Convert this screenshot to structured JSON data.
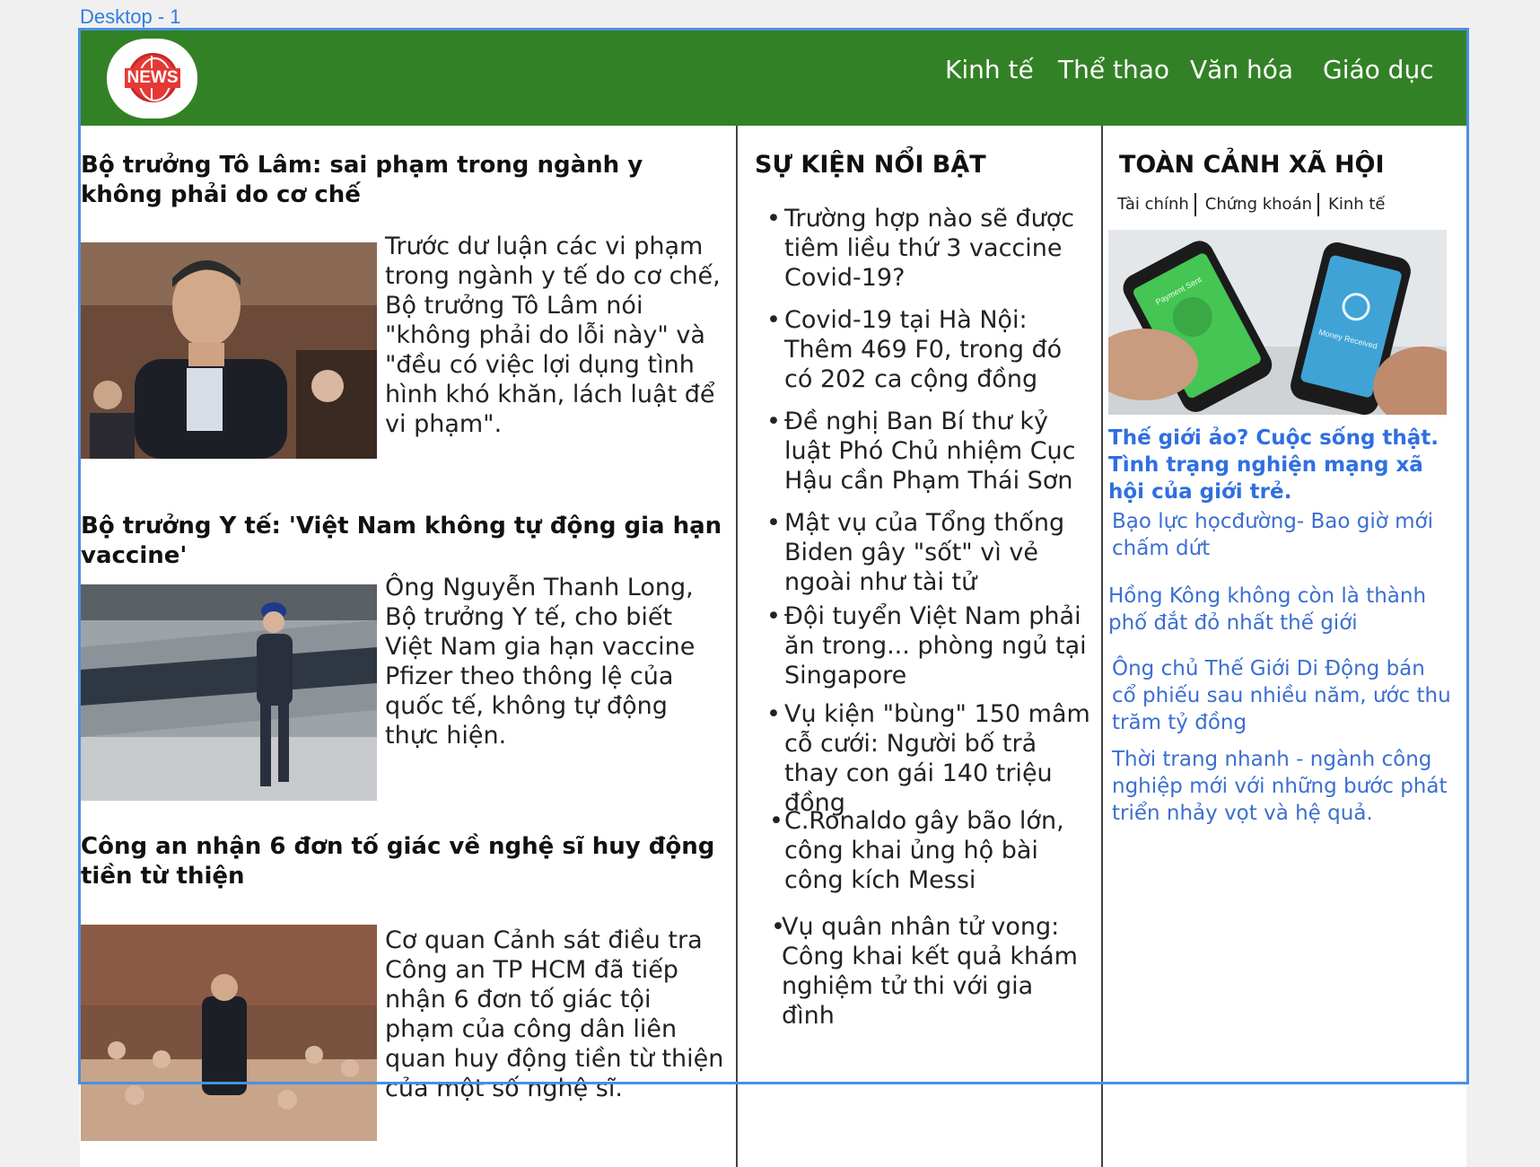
{
  "frame_label": "Desktop - 1",
  "logo": {
    "text": "NEWS"
  },
  "nav": [
    "Kinh tế",
    "Thể thao",
    "Văn hóa",
    "Giáo dục"
  ],
  "articles": [
    {
      "title": "Bộ trưởng Tô Lâm: sai phạm trong ngành y không phải do cơ chế",
      "desc": "Trước dư luận các vi phạm trong ngành y tế do cơ chế, Bộ trưởng Tô Lâm nói \"không phải do lỗi này\" và \"đều có việc lợi dụng tình hình khó khăn, lách luật để vi phạm\"."
    },
    {
      "title": "Bộ trưởng Y tế: 'Việt Nam không tự động gia hạn vaccine'",
      "desc": "Ông Nguyễn Thanh Long, Bộ trưởng Y tế, cho biết Việt Nam gia hạn vaccine Pfizer theo thông lệ của quốc tế, không tự động thực hiện."
    },
    {
      "title": "Công an nhận 6 đơn tố giác về nghệ sĩ huy động tiền từ thiện",
      "desc": "Cơ quan Cảnh sát điều tra Công an TP HCM đã tiếp nhận 6 đơn tố giác tội phạm của công dân liên quan huy động tiền từ thiện của một số nghệ sĩ."
    }
  ],
  "events": {
    "title": "SỰ KIỆN NỔI BẬT",
    "bullet": "•",
    "items": [
      "Trường hợp nào sẽ được tiêm liều thứ 3 vaccine Covid-19?",
      "Covid-19 tại Hà Nội: Thêm 469 F0, trong đó có 202 ca cộng đồng",
      "Đề nghị Ban Bí thư kỷ luật Phó Chủ nhiệm Cục Hậu cần Phạm Thái Sơn",
      "Mật vụ của Tổng thống Biden gây \"sốt\" vì vẻ ngoài như tài tử",
      "Đội tuyển Việt Nam phải ăn trong... phòng ngủ tại Singapore",
      "Vụ kiện \"bùng\" 150 mâm cỗ cưới: Người bố trả thay con gái 140 triệu đồng",
      "C.Ronaldo gây bão lớn, công khai ủng hộ bài công kích Messi",
      "Vụ quân nhân tử vong: Công khai kết quả khám nghiệm tử thi với gia đình"
    ]
  },
  "society": {
    "title": "TOÀN CẢNH XÃ HỘI",
    "tabs": [
      "Tài chính",
      "Chứng khoán",
      "Kinh tế"
    ],
    "image_text": {
      "left": "Payment Sent",
      "right": "Money Received"
    },
    "featured_title": "Thế giới ảo? Cuộc sống thật. Tình trạng nghiện mạng xã hội của giới trẻ.",
    "links": [
      "Bạo lực họcđường- Bao giờ mới chấm dứt",
      "Hồng Kông không còn là thành phố đắt đỏ nhất thế giới",
      "Ông chủ Thế Giới Di Động bán cổ phiếu sau nhiều năm, ước thu trăm tỷ đồng",
      "Thời trang nhanh - ngành công nghiệp mới với những bước phát triển nhảy vọt và hệ quả."
    ]
  },
  "colors": {
    "header": "#338126",
    "link": "#3b6fd0",
    "frame": "#4a90e2"
  }
}
